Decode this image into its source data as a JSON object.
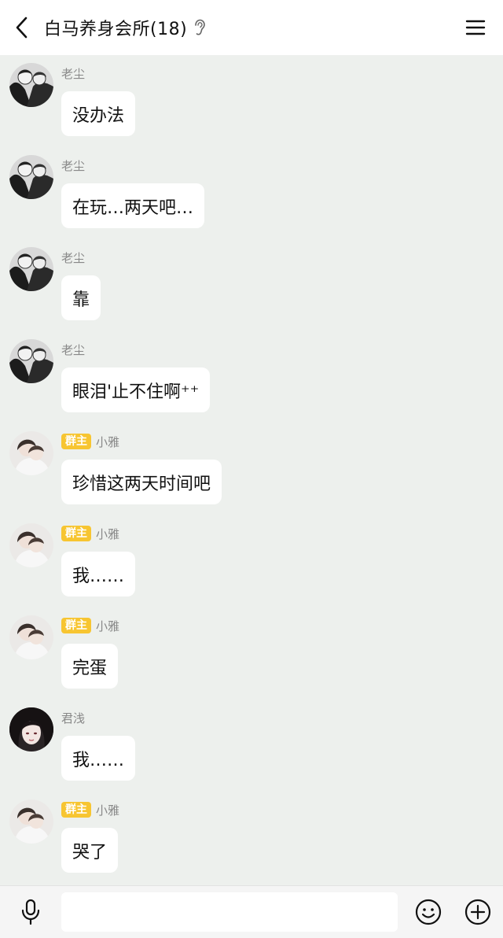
{
  "header": {
    "title": "白马养身会所(18)",
    "back_icon": "chevron-left-icon",
    "ear_icon": "ear-icon",
    "menu_icon": "hamburger-menu-icon"
  },
  "messages": [
    {
      "sender": "老尘",
      "badge": "",
      "text": "没办法",
      "avatar": "avatar-laochen"
    },
    {
      "sender": "老尘",
      "badge": "",
      "text": "在玩…两天吧…",
      "avatar": "avatar-laochen"
    },
    {
      "sender": "老尘",
      "badge": "",
      "text": "靠",
      "avatar": "avatar-laochen"
    },
    {
      "sender": "老尘",
      "badge": "",
      "text": "眼泪'止不住啊⁺⁺",
      "avatar": "avatar-laochen"
    },
    {
      "sender": "小雅",
      "badge": "群主",
      "text": "珍惜这两天时间吧",
      "avatar": "avatar-xiaoya"
    },
    {
      "sender": "小雅",
      "badge": "群主",
      "text": "我……",
      "avatar": "avatar-xiaoya"
    },
    {
      "sender": "小雅",
      "badge": "群主",
      "text": "完蛋",
      "avatar": "avatar-xiaoya"
    },
    {
      "sender": "君浅",
      "badge": "",
      "text": "我……",
      "avatar": "avatar-junqian"
    },
    {
      "sender": "小雅",
      "badge": "群主",
      "text": "哭了",
      "avatar": "avatar-xiaoya"
    }
  ],
  "composer": {
    "input_value": "",
    "input_placeholder": "",
    "mic_icon": "microphone-icon",
    "emoji_icon": "smiley-icon",
    "plus_icon": "plus-circle-icon"
  },
  "colors": {
    "chat_bg": "#edf0ed",
    "badge_bg": "#f7c531",
    "bubble_bg": "#ffffff"
  }
}
